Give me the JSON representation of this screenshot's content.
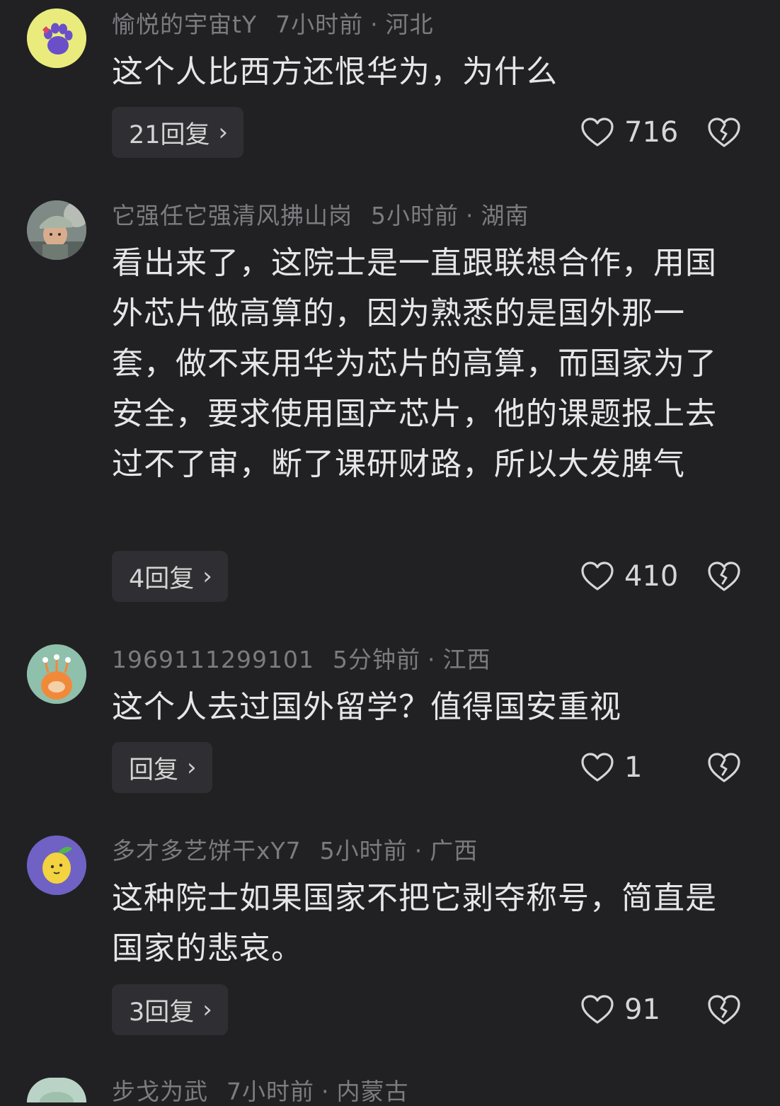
{
  "comments": [
    {
      "username": "愉悦的宇宙tY",
      "time": "7小时前",
      "location": "河北",
      "text": "这个人比西方还恨华为，为什么",
      "reply_label": "21回复",
      "likes": "716",
      "avatar_icon": "purple-paw-icon",
      "avatar_bg": "#e9ec7c"
    },
    {
      "username": "它强任它强清风拂山岗",
      "time": "5小时前",
      "location": "湖南",
      "text": "看出来了，这院士是一直跟联想合作，用国外芯片做高算的，因为熟悉的是国外那一套，做不来用华为芯片的高算，而国家为了安全，要求使用国产芯片，他的课题报上去过不了审，断了课研财路，所以大发脾气",
      "reply_label": "4回复",
      "likes": "410",
      "avatar_icon": "child-photo-avatar",
      "avatar_bg": "#7f8a86"
    },
    {
      "username": "1969111299101",
      "time": "5分钟前",
      "location": "江西",
      "text": "这个人去过国外留学？值得国安重视",
      "reply_label": "回复",
      "likes": "1",
      "avatar_icon": "orange-monster-icon",
      "avatar_bg": "#8fc0ab"
    },
    {
      "username": "多才多艺饼干xY7",
      "time": "5小时前",
      "location": "广西",
      "text": "这种院士如果国家不把它剥夺称号，简直是国家的悲哀。",
      "reply_label": "3回复",
      "likes": "91",
      "avatar_icon": "lemon-face-icon",
      "avatar_bg": "#6f62c4"
    },
    {
      "username": "步戈为武",
      "time": "7小时前",
      "location": "内蒙古",
      "avatar_icon": "partial-avatar",
      "avatar_bg": "#b9d4c6"
    }
  ],
  "meta_separator": "·",
  "reply_chevron": "›",
  "colors": {
    "background": "#212124",
    "meta_text": "#7c7c80",
    "body_text": "#e6e6e6",
    "reply_button_bg": "#2f2f33"
  }
}
